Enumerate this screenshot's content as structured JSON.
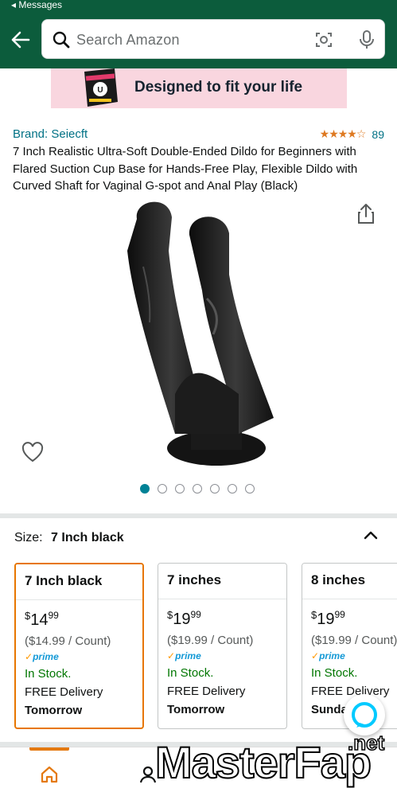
{
  "status_bar": {
    "back_label": "◂ Messages"
  },
  "header": {
    "search_placeholder": "Search Amazon"
  },
  "banner": {
    "text": "Designed to fit your life"
  },
  "product": {
    "brand": "Brand: Seiecft",
    "rating_stars": "★★★★☆",
    "rating_value": 4.3,
    "rating_count": "89",
    "title": "7 Inch Realistic Ultra-Soft Double-Ended Dildo for Beginners with Flared Suction Cup Base for Hands-Free Play, Flexible Dildo with Curved Shaft for Vaginal G-spot and Anal Play (Black)",
    "image_count": 7,
    "active_image_index": 0
  },
  "size": {
    "label": "Size:",
    "selected": "7 Inch black"
  },
  "variants": [
    {
      "name": "7 Inch black",
      "currency": "$",
      "price_whole": "14",
      "price_cents": "99",
      "unit_price": "($14.99 / Count)",
      "prime": "prime",
      "stock": "In Stock.",
      "delivery": "FREE Delivery",
      "delivery_day": "Tomorrow"
    },
    {
      "name": "7 inches",
      "currency": "$",
      "price_whole": "19",
      "price_cents": "99",
      "unit_price": "($19.99 / Count)",
      "prime": "prime",
      "stock": "In Stock.",
      "delivery": "FREE Delivery",
      "delivery_day": "Tomorrow"
    },
    {
      "name": "8 inches",
      "currency": "$",
      "price_whole": "19",
      "price_cents": "99",
      "unit_price": "($19.99 / Count)",
      "prime": "prime",
      "stock": "In Stock.",
      "delivery": "FREE Delivery",
      "delivery_day": "Sunda"
    }
  ],
  "watermark": {
    "text": "MasterFap",
    "suffix": ".net"
  },
  "colors": {
    "header_bg": "#0c5c3c",
    "link": "#007185",
    "accent": "#e77600",
    "stock": "#007600",
    "prime": "#1399d6"
  }
}
